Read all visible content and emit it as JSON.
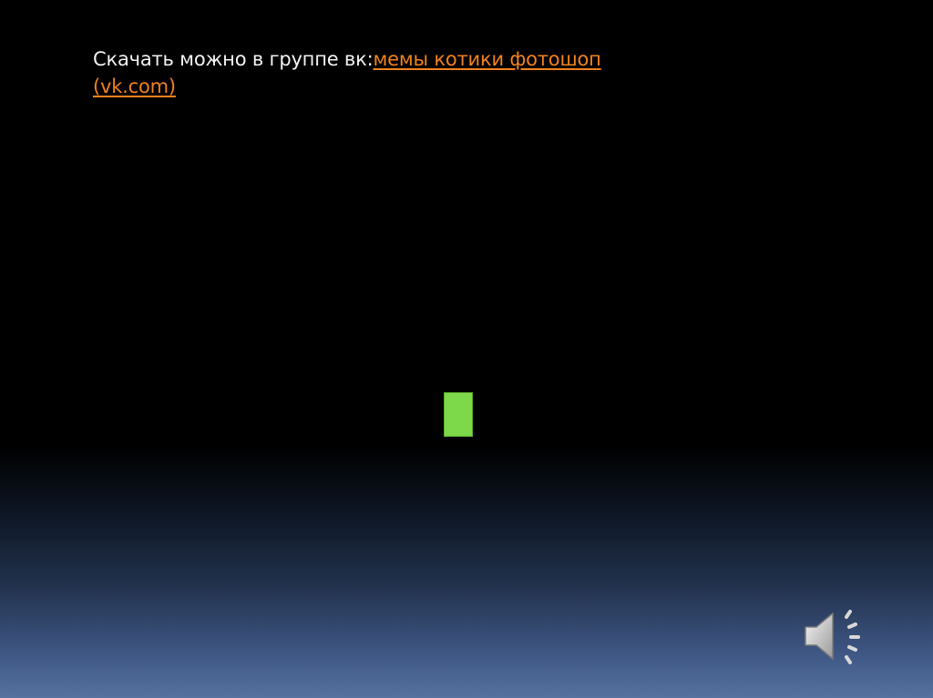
{
  "slide": {
    "text_prefix": "Скачать можно в группе вк:",
    "link_text": "мемы котики фотошоп (vk.com)"
  },
  "colors": {
    "link": "#f0821e",
    "text": "#f2f2f2",
    "shape": "#7ed94a"
  },
  "icons": {
    "audio": "speaker-icon"
  }
}
